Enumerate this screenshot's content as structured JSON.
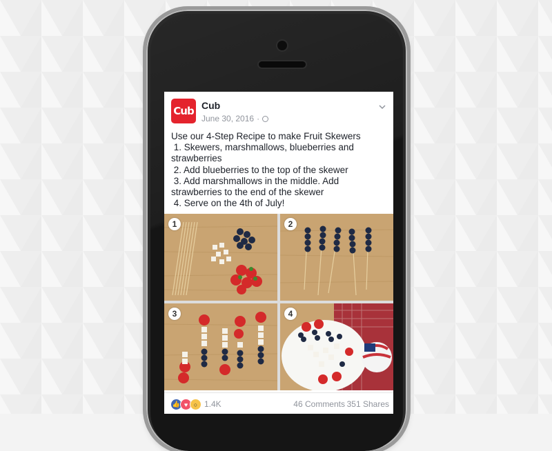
{
  "post": {
    "author": "Cub",
    "avatar_text": "Cub",
    "date": "June 30, 2016",
    "separator": "·",
    "text": "Use our 4-Step Recipe to make Fruit Skewers\n 1. Skewers, marshmallows, blueberries and strawberries\n 2. Add blueberries to the top of the skewer\n 3. Add marshmallows in the middle. Add strawberries to the end of the skewer\n 4. Serve on the 4th of July!",
    "photos": [
      {
        "step": "1",
        "icon": "skewers-ingredients-photo"
      },
      {
        "step": "2",
        "icon": "blueberry-skewers-photo"
      },
      {
        "step": "3",
        "icon": "assembled-skewers-photo"
      },
      {
        "step": "4",
        "icon": "served-skewers-photo"
      }
    ]
  },
  "footer": {
    "reaction_count": "1.4K",
    "comments": "46 Comments",
    "shares": "351 Shares"
  },
  "colors": {
    "brand_red": "#e4232d",
    "wood": "#c9a472",
    "blueberry": "#1f2a44",
    "strawberry": "#d42a2a",
    "like_blue": "#4267b2"
  }
}
